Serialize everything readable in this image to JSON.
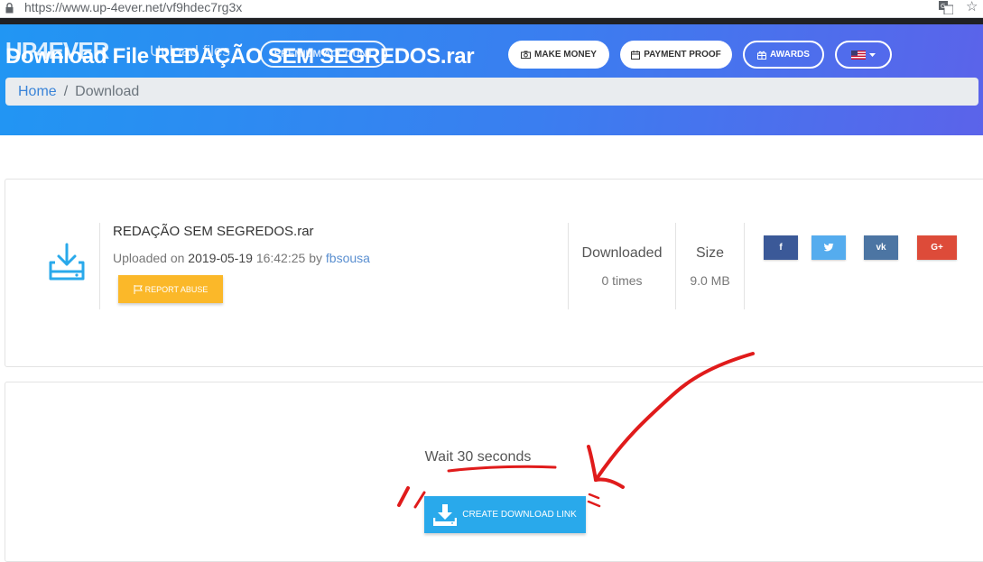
{
  "browser": {
    "url": "https://www.up-4ever.net/vf9hdec7rg3x"
  },
  "header": {
    "logo": "UP4EVER",
    "upload_link": "Upload files",
    "ghost_pill": "PREMIUM ACCOUNT",
    "page_title": "Download File REDAÇÃO SEM SEGREDOS.rar",
    "make_money": "MAKE MONEY",
    "payment_proof": "PAYMENT PROOF",
    "awards": "AWARDS"
  },
  "breadcrumb": {
    "home": "Home",
    "separator": "/",
    "current": "Download"
  },
  "file": {
    "name": "REDAÇÃO SEM SEGREDOS.rar",
    "uploaded_on_label": "Uploaded on",
    "date": "2019-05-19",
    "time": "16:42:25",
    "by_label": "by",
    "uploader": "fbsousa",
    "report_label": "REPORT ABUSE",
    "downloaded_label": "Downloaded",
    "downloaded_value": "0 times",
    "size_label": "Size",
    "size_value": "9.0 MB"
  },
  "share": {
    "facebook": "f",
    "twitter": "t",
    "vk": "vk",
    "googleplus": "G+"
  },
  "download": {
    "wait_text": "Wait 30 seconds",
    "create_label": "CREATE DOWNLOAD LINK"
  },
  "colors": {
    "facebook": "#3b5998",
    "twitter": "#55acee",
    "vk": "#4c75a3",
    "googleplus": "#dd4b39",
    "report": "#fbb829",
    "create": "#29a9eb",
    "annotation": "#e01b1b"
  }
}
